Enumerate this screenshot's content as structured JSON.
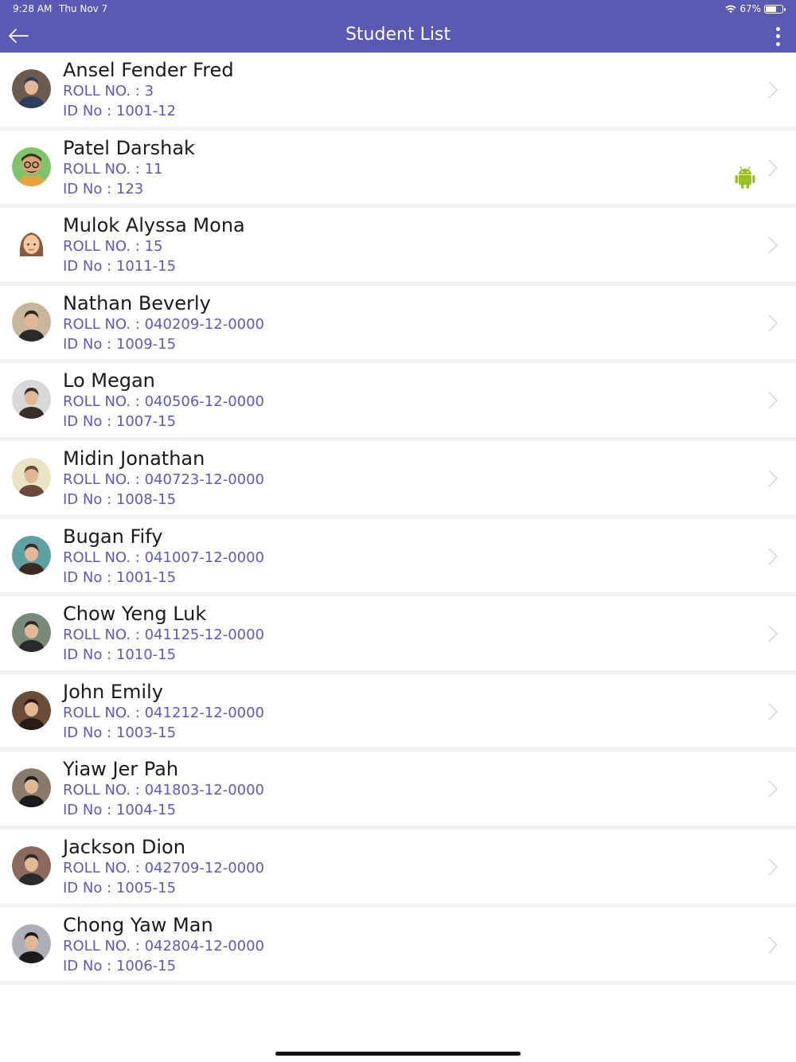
{
  "status_bar": {
    "time": "9:28 AM",
    "date": "Thu Nov 7",
    "battery": "67%",
    "battery_level": 0.67
  },
  "header": {
    "title": "Student List"
  },
  "colors": {
    "header_bg": "#5a59b4",
    "accent_text": "#5b5bb8",
    "android": "#97c024"
  },
  "students": [
    {
      "name": "Ansel Fender Fred",
      "roll": "ROLL NO. : 3",
      "id": "ID No : 1001-12",
      "avatar": "photo-avatar",
      "platform": ""
    },
    {
      "name": "Patel Darshak",
      "roll": "ROLL NO. : 11",
      "id": "ID No : 123",
      "avatar": "cartoon-man-avatar",
      "platform": "android-icon"
    },
    {
      "name": "Mulok Alyssa Mona",
      "roll": "ROLL NO. : 15",
      "id": "ID No : 1011-15",
      "avatar": "cartoon-girl-avatar",
      "platform": ""
    },
    {
      "name": "Nathan Beverly",
      "roll": "ROLL NO. : 040209-12-0000",
      "id": "ID No : 1009-15",
      "avatar": "photo-avatar",
      "platform": ""
    },
    {
      "name": "Lo Megan",
      "roll": "ROLL NO. : 040506-12-0000",
      "id": "ID No : 1007-15",
      "avatar": "photo-avatar",
      "platform": ""
    },
    {
      "name": "Midin Jonathan",
      "roll": "ROLL NO. : 040723-12-0000",
      "id": "ID No : 1008-15",
      "avatar": "photo-avatar",
      "platform": ""
    },
    {
      "name": "Bugan Fify",
      "roll": "ROLL NO. : 041007-12-0000",
      "id": "ID No : 1001-15",
      "avatar": "photo-avatar",
      "platform": ""
    },
    {
      "name": "Chow Yeng Luk",
      "roll": "ROLL NO. : 041125-12-0000",
      "id": "ID No : 1010-15",
      "avatar": "photo-avatar",
      "platform": ""
    },
    {
      "name": "John Emily",
      "roll": "ROLL NO. : 041212-12-0000",
      "id": "ID No : 1003-15",
      "avatar": "photo-avatar",
      "platform": ""
    },
    {
      "name": "Yiaw Jer Pah",
      "roll": "ROLL NO. : 041803-12-0000",
      "id": "ID No : 1004-15",
      "avatar": "photo-avatar",
      "platform": ""
    },
    {
      "name": "Jackson Dion",
      "roll": "ROLL NO. : 042709-12-0000",
      "id": "ID No : 1005-15",
      "avatar": "photo-avatar",
      "platform": ""
    },
    {
      "name": "Chong Yaw Man",
      "roll": "ROLL NO. : 042804-12-0000",
      "id": "ID No : 1006-15",
      "avatar": "photo-avatar",
      "platform": ""
    }
  ]
}
